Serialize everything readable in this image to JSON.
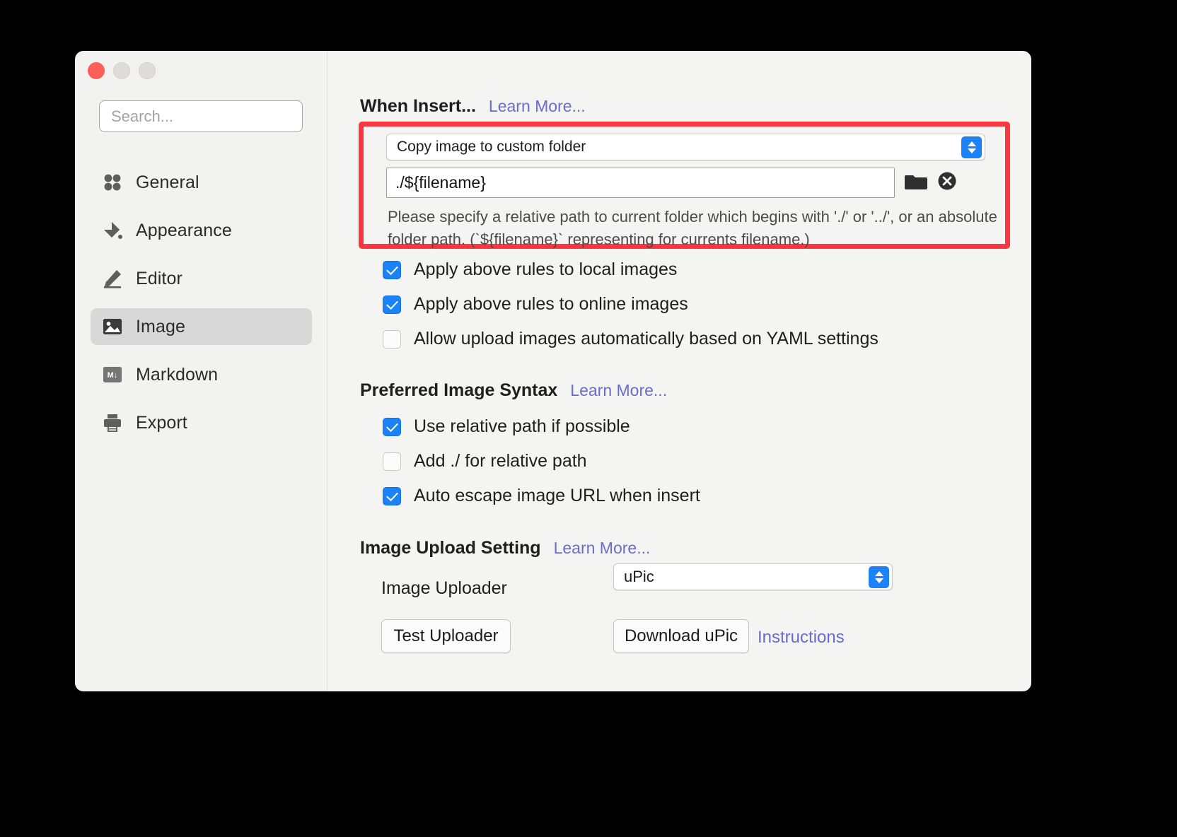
{
  "window": {
    "traffic_lights": [
      "close",
      "minimize",
      "zoom"
    ],
    "accent_blue": "#1b82f7",
    "highlight_red": "#fb3640",
    "link_color": "#6c6ccb"
  },
  "sidebar": {
    "search": {
      "placeholder": "Search...",
      "value": ""
    },
    "items": [
      {
        "label": "General",
        "icon": "four-dots-icon",
        "active": false
      },
      {
        "label": "Appearance",
        "icon": "paint-bucket-icon",
        "active": false
      },
      {
        "label": "Editor",
        "icon": "pencil-icon",
        "active": false
      },
      {
        "label": "Image",
        "icon": "picture-icon",
        "active": true
      },
      {
        "label": "Markdown",
        "icon": "markdown-icon",
        "active": false
      },
      {
        "label": "Export",
        "icon": "printer-icon",
        "active": false
      }
    ]
  },
  "main": {
    "when_insert": {
      "title": "When Insert...",
      "learn_more": "Learn More...",
      "insert_action_select": {
        "value": "Copy image to custom folder"
      },
      "path_field": {
        "value": "./${filename}",
        "placeholder": ""
      },
      "folder_button_icon": "folder-icon",
      "clear_button_icon": "clear-circle-icon",
      "helper_text": "Please specify a relative path to current folder which begins with './' or '../', or an absolute folder path. (`${filename}` representing for currents filename.)",
      "checkboxes": [
        {
          "label": "Apply above rules to local images",
          "checked": true
        },
        {
          "label": "Apply above rules to online images",
          "checked": true
        },
        {
          "label": "Allow upload images automatically based on YAML settings",
          "checked": false
        }
      ]
    },
    "preferred_image_syntax": {
      "title": "Preferred Image Syntax",
      "learn_more": "Learn More...",
      "checkboxes": [
        {
          "label": "Use relative path if possible",
          "checked": true,
          "help": false
        },
        {
          "label": "Add ./ for relative path",
          "checked": false,
          "help": true
        },
        {
          "label": "Auto escape image URL when insert",
          "checked": true,
          "help": true
        }
      ],
      "help_glyph": "?"
    },
    "image_upload_setting": {
      "title": "Image Upload Setting",
      "learn_more": "Learn More...",
      "uploader_label": "Image Uploader",
      "uploader_value": "uPic",
      "test_button": "Test Uploader",
      "download_button": "Download uPic",
      "instructions_link": "Instructions"
    }
  }
}
